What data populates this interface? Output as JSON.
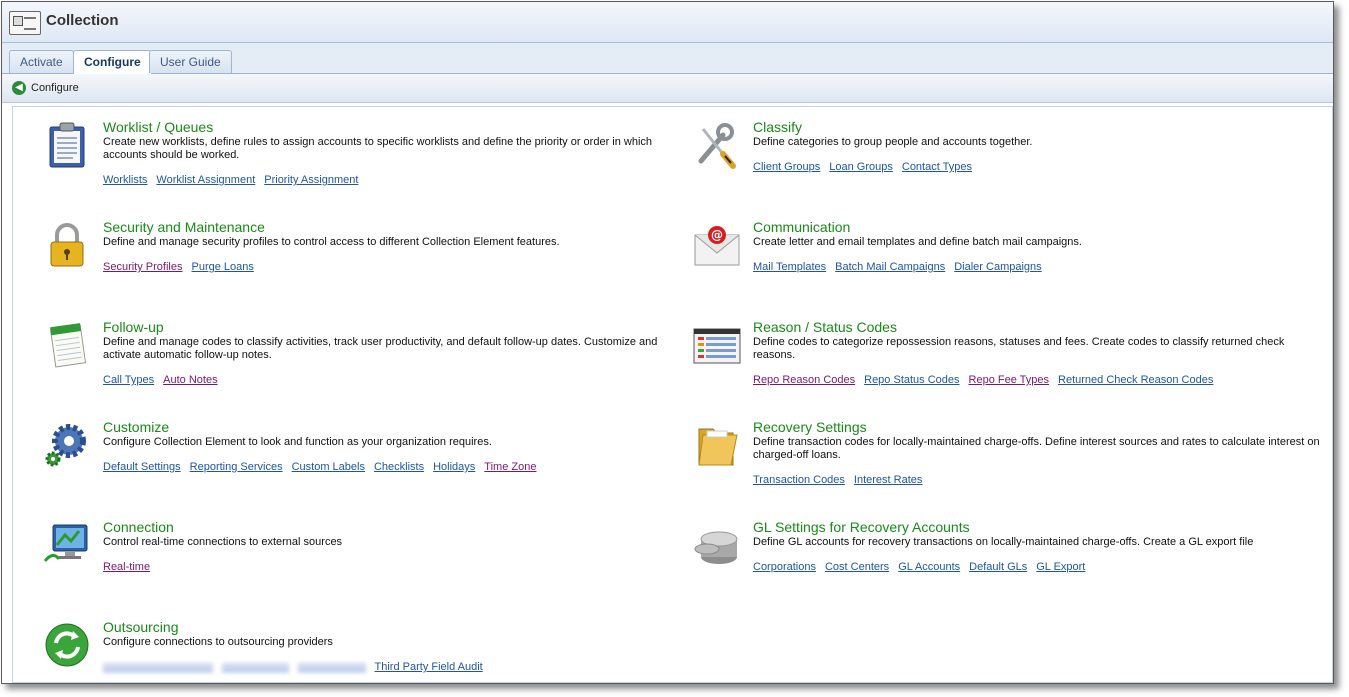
{
  "app": {
    "title": "Collection"
  },
  "tabs": [
    {
      "label": "Activate",
      "active": false
    },
    {
      "label": "Configure",
      "active": true
    },
    {
      "label": "User Guide",
      "active": false
    }
  ],
  "breadcrumb": {
    "label": "Configure"
  },
  "sections": {
    "worklist": {
      "title": "Worklist / Queues",
      "description": "Create new worklists, define rules to assign accounts to specific worklists and define the priority or order in which accounts should be worked.",
      "links": [
        "Worklists",
        "Worklist Assignment",
        "Priority Assignment"
      ]
    },
    "classify": {
      "title": "Classify",
      "description": "Define categories to group people and accounts together.",
      "links": [
        "Client Groups",
        "Loan Groups",
        "Contact Types"
      ]
    },
    "security": {
      "title": "Security and Maintenance",
      "description": "Define and manage security profiles to control access to different Collection Element features.",
      "links": [
        "Security Profiles",
        "Purge Loans"
      ]
    },
    "communication": {
      "title": "Communication",
      "description": "Create letter and email templates and define batch mail campaigns.",
      "links": [
        "Mail Templates",
        "Batch Mail Campaigns",
        "Dialer Campaigns"
      ]
    },
    "followup": {
      "title": "Follow-up",
      "description": "Define and manage codes to classify activities, track user productivity, and default follow-up dates. Customize and activate automatic follow-up notes.",
      "links": [
        "Call Types",
        "Auto Notes"
      ]
    },
    "reason": {
      "title": "Reason / Status Codes",
      "description": "Define codes to categorize repossession reasons, statuses and fees. Create codes to classify returned check reasons.",
      "links": [
        "Repo Reason Codes",
        "Repo Status Codes",
        "Repo Fee Types",
        "Returned Check Reason Codes"
      ]
    },
    "customize": {
      "title": "Customize",
      "description": "Configure Collection Element to look and function as your organization requires.",
      "links": [
        "Default Settings",
        "Reporting Services",
        "Custom Labels",
        "Checklists",
        "Holidays",
        "Time Zone"
      ]
    },
    "recovery": {
      "title": "Recovery Settings",
      "description": "Define transaction codes for locally-maintained charge-offs. Define interest sources and rates to calculate interest on charged-off loans.",
      "links": [
        "Transaction Codes",
        "Interest Rates"
      ]
    },
    "connection": {
      "title": "Connection",
      "description": "Control real-time connections to external sources",
      "links": [
        "Real-time"
      ]
    },
    "gl": {
      "title": "GL Settings for Recovery Accounts",
      "description": "Define GL accounts for recovery transactions on locally-maintained charge-offs. Create a GL export file",
      "links": [
        "Corporations",
        "Cost Centers",
        "GL Accounts",
        "Default GLs",
        "GL Export"
      ]
    },
    "outsourcing": {
      "title": "Outsourcing",
      "description": "Configure connections to outsourcing providers",
      "links": [
        "Third Party Field Audit"
      ]
    }
  }
}
